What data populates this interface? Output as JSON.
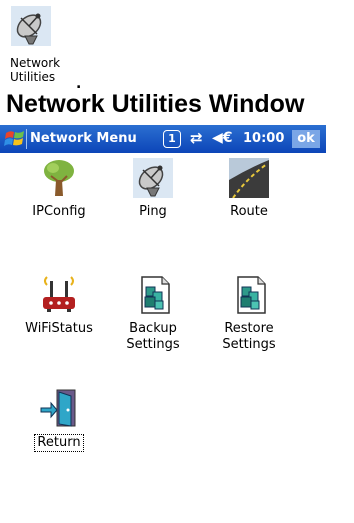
{
  "desktop_icon": {
    "label_line1": "Network",
    "label_line2": "Utilities"
  },
  "marker": ".",
  "heading": "Network Utilities Window",
  "titlebar": {
    "title": "Network Menu",
    "badge": "1",
    "time": "10:00",
    "ok_label": "ok",
    "conn_glyph": "⇄",
    "vol_glyph": "◀€"
  },
  "apps": [
    {
      "label": "IPConfig",
      "icon": "tree-icon"
    },
    {
      "label": "Ping",
      "icon": "satellite-dish-icon"
    },
    {
      "label": "Route",
      "icon": "road-icon"
    },
    {
      "label": "WiFiStatus",
      "icon": "wifi-router-icon"
    },
    {
      "label_line1": "Backup",
      "label_line2": "Settings",
      "icon": "settings-document-icon"
    },
    {
      "label_line1": "Restore",
      "label_line2": "Settings",
      "icon": "settings-document-icon"
    },
    {
      "label": "Return",
      "icon": "exit-door-icon"
    }
  ]
}
